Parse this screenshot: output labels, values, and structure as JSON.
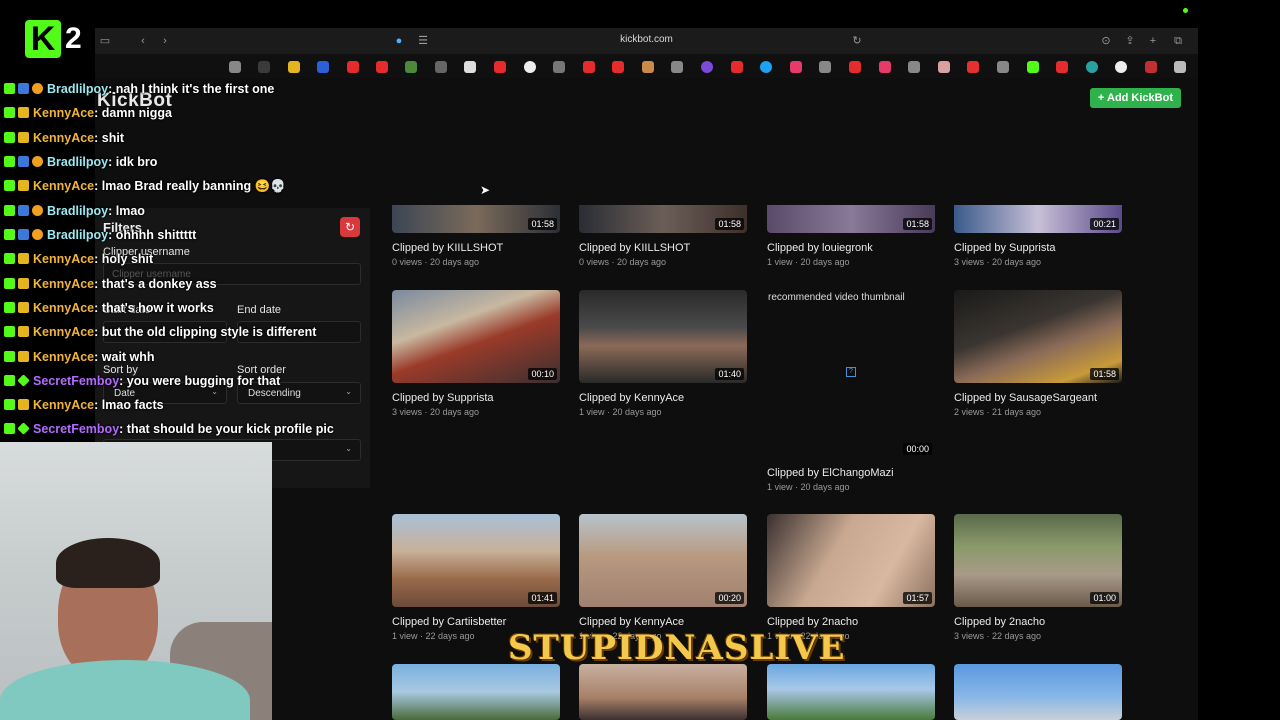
{
  "browser": {
    "url": "kickbot.com"
  },
  "page": {
    "logo": "KickBot",
    "add_button": "+ Add KickBot"
  },
  "filters": {
    "title": "Filters",
    "clipper_label": "Clipper username",
    "clipper_placeholder": "Clipper username",
    "start_label": "Start date",
    "end_label": "End date",
    "sort_by_label": "Sort by",
    "sort_by_value": "Date",
    "sort_order_label": "Sort order",
    "sort_order_value": "Descending"
  },
  "clips": [
    {
      "title": "Clipped by KIILLSHOT",
      "meta": "0 views · 20 days ago",
      "duration": "01:58"
    },
    {
      "title": "Clipped by KIILLSHOT",
      "meta": "0 views · 20 days ago",
      "duration": "01:58"
    },
    {
      "title": "Clipped by louiegronk",
      "meta": "1 view · 20 days ago",
      "duration": "01:58"
    },
    {
      "title": "Clipped by Supprista",
      "meta": "3 views · 20 days ago",
      "duration": "00:21"
    },
    {
      "title": "Clipped by Supprista",
      "meta": "3 views · 20 days ago",
      "duration": "00:10"
    },
    {
      "title": "Clipped by KennyAce",
      "meta": "1 view · 20 days ago",
      "duration": "01:40"
    },
    {
      "title": "Clipped by ElChangoMazi",
      "meta": "1 view · 20 days ago",
      "duration": "00:00",
      "alt": "recommended video thumbnail"
    },
    {
      "title": "Clipped by SausageSargeant",
      "meta": "2 views · 21 days ago",
      "duration": "01:58"
    },
    {
      "title": "Clipped by Cartiisbetter",
      "meta": "1 view · 22 days ago",
      "duration": "01:41"
    },
    {
      "title": "Clipped by KennyAce",
      "meta": "1 view · 22 days ago",
      "duration": "00:20"
    },
    {
      "title": "Clipped by 2nacho",
      "meta": "1 view · 22 days ago",
      "duration": "01:57"
    },
    {
      "title": "Clipped by 2nacho",
      "meta": "3 views · 22 days ago",
      "duration": "01:00"
    }
  ],
  "stream": {
    "channel_number": "2",
    "overlay_title": "STUPIDNASLIVE"
  },
  "chat": [
    {
      "user": "Bradlilpoy",
      "text": ": nah I think it's the first one",
      "color": "#9be8f0",
      "badges": [
        "green",
        "blue",
        "orange"
      ]
    },
    {
      "user": "KennyAce",
      "text": ": damn nigga",
      "color": "#f0b43a",
      "badges": [
        "green",
        "gold"
      ]
    },
    {
      "user": "KennyAce",
      "text": ": shit",
      "color": "#f0b43a",
      "badges": [
        "green",
        "gold"
      ]
    },
    {
      "user": "Bradlilpoy",
      "text": ": idk bro",
      "color": "#9be8f0",
      "badges": [
        "green",
        "blue",
        "orange"
      ]
    },
    {
      "user": "KennyAce",
      "text": ": lmao Brad really banning 😆💀",
      "color": "#f0b43a",
      "badges": [
        "green",
        "gold"
      ]
    },
    {
      "user": "Bradlilpoy",
      "text": ": lmao",
      "color": "#9be8f0",
      "badges": [
        "green",
        "blue",
        "orange"
      ]
    },
    {
      "user": "Bradlilpoy",
      "text": ": ohhhh shittttt",
      "color": "#9be8f0",
      "badges": [
        "green",
        "blue",
        "orange"
      ]
    },
    {
      "user": "KennyAce",
      "text": ": holy shit",
      "color": "#f0b43a",
      "badges": [
        "green",
        "gold"
      ]
    },
    {
      "user": "KennyAce",
      "text": ": that's a donkey ass",
      "color": "#f0b43a",
      "badges": [
        "green",
        "gold"
      ]
    },
    {
      "user": "KennyAce",
      "text": ": that's how it works",
      "color": "#f0b43a",
      "badges": [
        "green",
        "gold"
      ]
    },
    {
      "user": "KennyAce",
      "text": ": but the old clipping style is different",
      "color": "#f0b43a",
      "badges": [
        "green",
        "gold"
      ]
    },
    {
      "user": "KennyAce",
      "text": ": wait whh",
      "color": "#f0b43a",
      "badges": [
        "green",
        "gold"
      ]
    },
    {
      "user": "SecretFemboy",
      "text": ": you were bugging for that",
      "color": "#b36bff",
      "badges": [
        "green",
        "diamond"
      ]
    },
    {
      "user": "KennyAce",
      "text": ": lmao facts",
      "color": "#f0b43a",
      "badges": [
        "green",
        "gold"
      ]
    },
    {
      "user": "SecretFemboy",
      "text": ": that should be your kick profile pic",
      "color": "#b36bff",
      "badges": [
        "green",
        "diamond"
      ]
    }
  ]
}
